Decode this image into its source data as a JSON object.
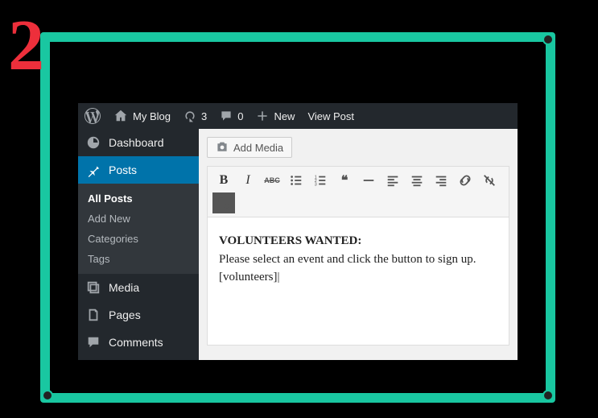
{
  "step": "2",
  "adminbar": {
    "site_name": "My Blog",
    "updates": "3",
    "comments": "0",
    "new_label": "New",
    "view_post": "View Post"
  },
  "sidebar": {
    "dashboard": "Dashboard",
    "posts": "Posts",
    "posts_sub": {
      "all": "All Posts",
      "add_new": "Add New",
      "categories": "Categories",
      "tags": "Tags"
    },
    "media": "Media",
    "pages": "Pages",
    "comments": "Comments"
  },
  "editor": {
    "add_media": "Add Media",
    "content": {
      "heading": "VOLUNTEERS WANTED:",
      "body": "Please select an event and click the button to sign up.",
      "shortcode": "[volunteers]"
    }
  }
}
